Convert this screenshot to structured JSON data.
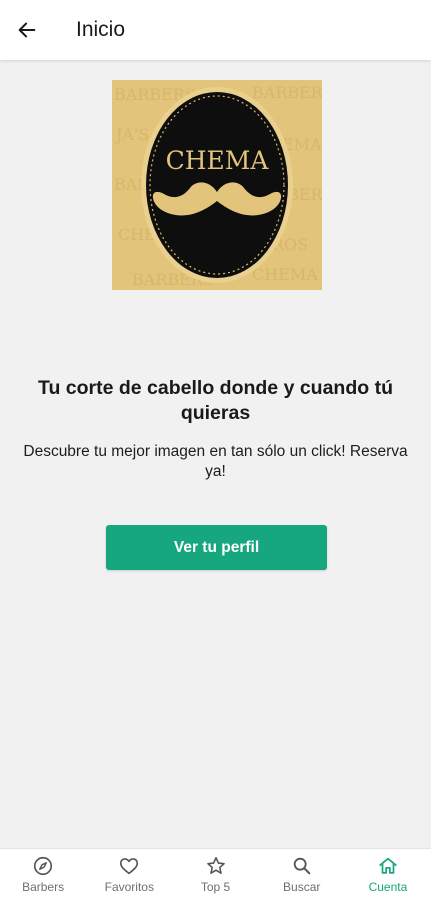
{
  "header": {
    "title": "Inicio"
  },
  "logo": {
    "brand_text": "CHEMA"
  },
  "hero": {
    "headline": "Tu corte de cabello donde y cuando tú quieras",
    "subtext": "Descubre tu mejor imagen en tan sólo un click! Reserva ya!",
    "cta_label": "Ver tu perfil"
  },
  "nav": {
    "items": [
      {
        "label": "Barbers",
        "icon": "compass-icon"
      },
      {
        "label": "Favoritos",
        "icon": "heart-icon"
      },
      {
        "label": "Top 5",
        "icon": "star-icon"
      },
      {
        "label": "Buscar",
        "icon": "search-icon"
      },
      {
        "label": "Cuenta",
        "icon": "home-icon",
        "active": true
      }
    ]
  },
  "colors": {
    "accent": "#16a77f",
    "logo_gold": "#e2c47a",
    "logo_dark": "#0e0e0e"
  }
}
